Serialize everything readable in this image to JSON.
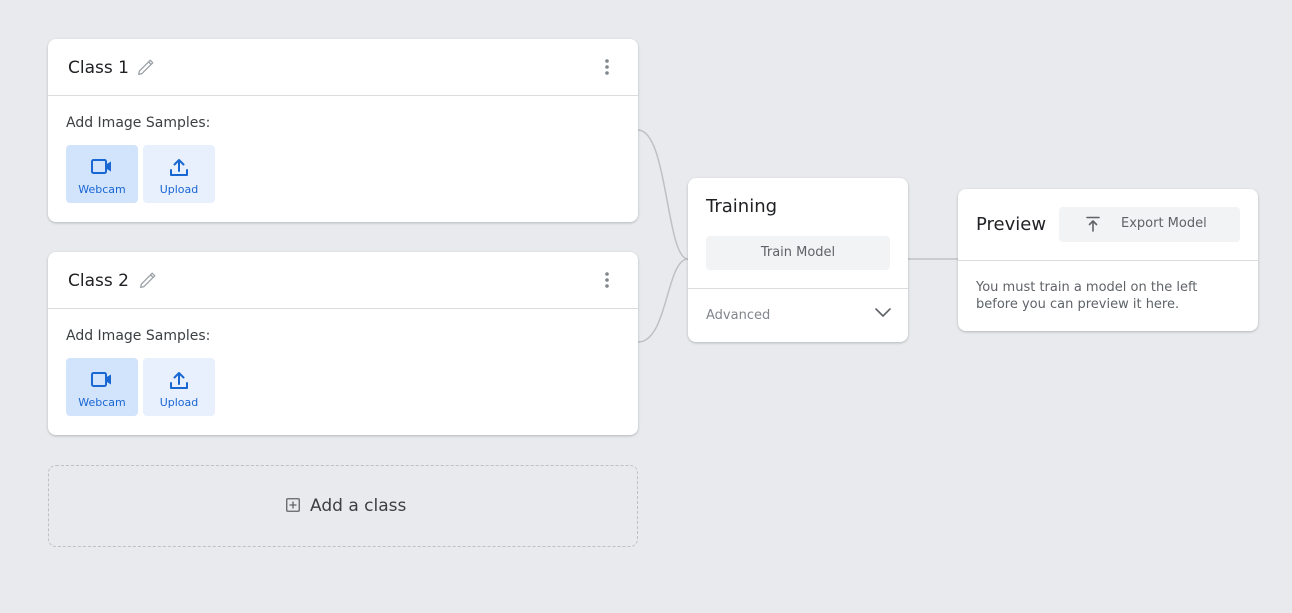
{
  "classes": [
    {
      "title": "Class 1",
      "samples_label": "Add Image Samples:",
      "webcam_label": "Webcam",
      "upload_label": "Upload"
    },
    {
      "title": "Class 2",
      "samples_label": "Add Image Samples:",
      "webcam_label": "Webcam",
      "upload_label": "Upload"
    }
  ],
  "add_class": {
    "label": "Add a class",
    "icon": "plus-box-icon"
  },
  "training": {
    "title": "Training",
    "train_button": "Train Model",
    "advanced_label": "Advanced"
  },
  "preview": {
    "title": "Preview",
    "export_button": "Export Model",
    "message": "You must train a model on the left before you can preview it here."
  },
  "colors": {
    "background": "#e8eaed",
    "accent": "#1967d2",
    "accent_bg": "#e8f0fe",
    "accent_bg_selected": "#d2e3fc",
    "connector": "#bdc1c6"
  },
  "icons": [
    "pencil-icon",
    "more-vert-icon",
    "webcam-icon",
    "upload-icon",
    "plus-box-icon",
    "chevron-down-icon",
    "export-icon"
  ]
}
